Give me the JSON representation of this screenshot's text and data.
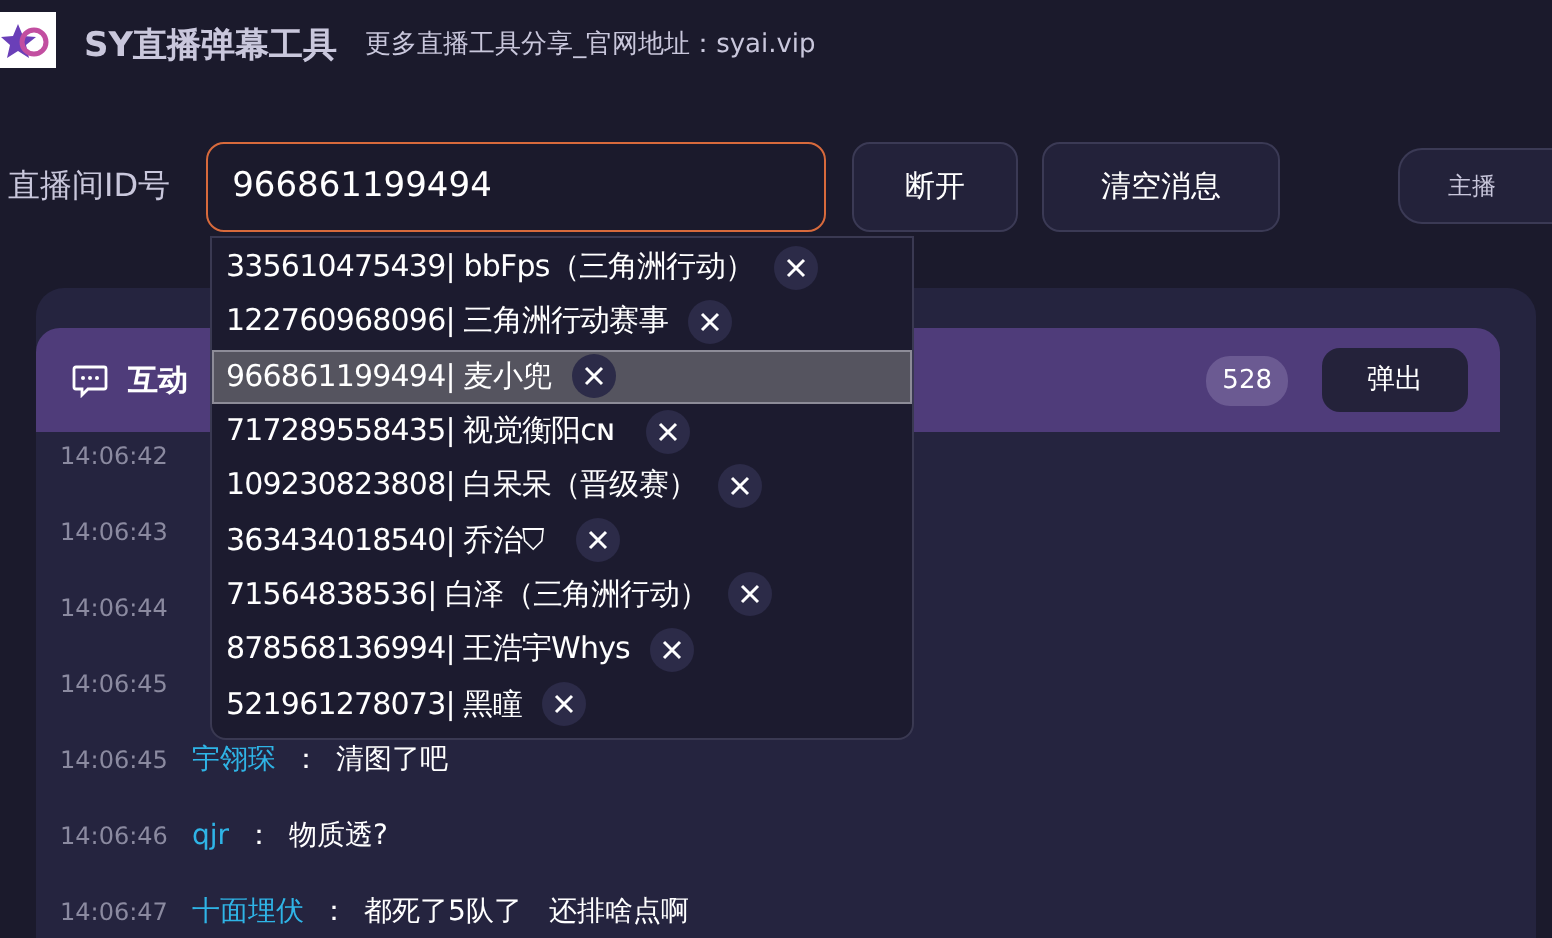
{
  "app": {
    "title": "SY直播弹幕工具",
    "subtitle": "更多直播工具分享_官网地址：syai.vip"
  },
  "toolbar": {
    "label": "直播间ID号",
    "room_id": "966861199494",
    "buttons": [
      "断开",
      "清空消息"
    ],
    "cut_button": "主播"
  },
  "history": [
    {
      "label": "335610475439| bbFps（三角洲行动）",
      "selected": false
    },
    {
      "label": "122760968096| 三角洲行动赛事",
      "selected": false
    },
    {
      "label": "966861199494| 麦小兜",
      "selected": true
    },
    {
      "label": "717289558435| 视觉衡阳ᴄɴ",
      "selected": false
    },
    {
      "label": "109230823808| 白呆呆（晋级赛）",
      "selected": false
    },
    {
      "label": "363434018540| 乔治⛉",
      "selected": false
    },
    {
      "label": "71564838536| 白泽（三角洲行动）",
      "selected": false
    },
    {
      "label": "878568136994| 王浩宇Whys",
      "selected": false
    },
    {
      "label": "521961278073| 黑瞳",
      "selected": false
    }
  ],
  "panel": {
    "title": "互动",
    "count": "528",
    "popout": "弹出"
  },
  "messages": [
    {
      "time": "14:06:42"
    },
    {
      "time": "14:06:43"
    },
    {
      "time": "14:06:44"
    },
    {
      "time": "14:06:45"
    },
    {
      "time": "14:06:45",
      "user": "宇翎琛",
      "separator": "：",
      "text": "清图了吧"
    },
    {
      "time": "14:06:46",
      "user": "qjr",
      "separator": "：",
      "text": "物质透?"
    },
    {
      "time": "14:06:47",
      "user": "十面埋伏",
      "separator": "：",
      "text": "都死了5队了   还排啥点啊"
    }
  ]
}
